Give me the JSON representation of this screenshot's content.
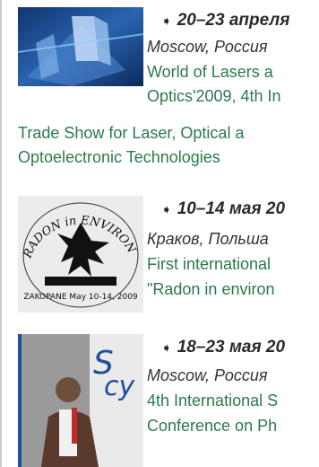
{
  "events": [
    {
      "date": "20–23 апреля",
      "location": "Moscow, Россия",
      "title_lines": [
        "World of Lasers a",
        "Optics'2009, 4th In",
        "Trade Show for Laser, Optical a",
        "Optoelectronic Technologies"
      ]
    },
    {
      "date": "10–14 мая 20",
      "location": "Краков, Польша",
      "title_lines": [
        "First international",
        "\"Radon in environ"
      ],
      "image": {
        "top_text": "RADON in ENVIRONMENT",
        "bottom_text": "ZAKOPANE May 10-14, 2009"
      }
    },
    {
      "date": "18–23 мая 20",
      "location": "Moscow, Россия",
      "title_lines": [
        "4th International S",
        "Conference on Ph"
      ]
    }
  ],
  "colors": {
    "link": "#2a7a4a",
    "date": "#2a2a2a",
    "location": "#333333"
  }
}
